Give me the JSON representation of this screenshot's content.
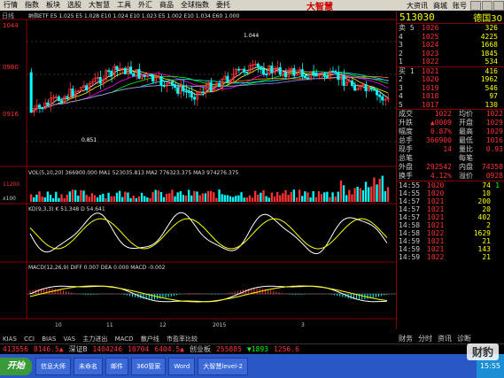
{
  "menu": {
    "items": [
      "行情",
      "指数",
      "板块",
      "选股",
      "大智慧",
      "工具",
      "外汇",
      "商品",
      "全球指数",
      "委托"
    ],
    "brand": "大智慧",
    "right_items": [
      "大资讯",
      "商城",
      "账号"
    ]
  },
  "chart_header": {
    "period": "日线",
    "ohlc_text": "纳指ETF  E5 1.025  E5 1.028  E10 1.024  E10 1.023  E5 1.002  E10 1.034  E60 1.000"
  },
  "price_axis": [
    "1044",
    "0980",
    "0916"
  ],
  "price_markers": {
    "high": "1.044",
    "low": "0.851"
  },
  "volume": {
    "title": "VOL(5,10,20)  366900.000  MA1 523035.813  MA2 776323.375  MA3 974276.375",
    "axis": [
      "11200",
      "x100"
    ]
  },
  "kdj": {
    "title": "KD(9,3,3)  K 51.348  D 54.641"
  },
  "macd": {
    "title": "MACD(12,26,9)  DIFF 0.007  DEA 0.000  MACD -0.002"
  },
  "x_axis": [
    "10",
    "11",
    "12",
    "2015",
    "3"
  ],
  "indicator_tabs": [
    "KIAS",
    "CCI",
    "BIAS",
    "VAS",
    "主力进出",
    "MACD",
    "散户线",
    "市盈率比较"
  ],
  "quote": {
    "code": "513030",
    "name": "德国30",
    "sell_label": "卖",
    "buy_label": "买",
    "sells": [
      {
        "lvl": "5",
        "p": "1026",
        "v": "326"
      },
      {
        "lvl": "4",
        "p": "1025",
        "v": "4225"
      },
      {
        "lvl": "3",
        "p": "1024",
        "v": "1668"
      },
      {
        "lvl": "2",
        "p": "1023",
        "v": "1845"
      },
      {
        "lvl": "1",
        "p": "1022",
        "v": "534"
      }
    ],
    "buys": [
      {
        "lvl": "1",
        "p": "1021",
        "v": "416"
      },
      {
        "lvl": "2",
        "p": "1020",
        "v": "1962"
      },
      {
        "lvl": "3",
        "p": "1019",
        "v": "546"
      },
      {
        "lvl": "4",
        "p": "1018",
        "v": "97"
      },
      {
        "lvl": "5",
        "p": "1017",
        "v": "130"
      }
    ],
    "stats": [
      {
        "l1": "成交",
        "v1": "1022",
        "l2": "均价",
        "v2": "1022"
      },
      {
        "l1": "升跌",
        "v1": "▲0009",
        "l2": "开盘",
        "v2": "1029"
      },
      {
        "l1": "幅度",
        "v1": "0.87%",
        "l2": "最高",
        "v2": "1029"
      },
      {
        "l1": "总手",
        "v1": "366900",
        "l2": "最低",
        "v2": "1016"
      },
      {
        "l1": "现手",
        "v1": "14",
        "l2": "量比",
        "v2": "0.93"
      },
      {
        "l1": "总笔",
        "v1": "",
        "l2": "每笔",
        "v2": ""
      },
      {
        "l1": "外盘",
        "v1": "292542",
        "l2": "内盘",
        "v2": "74358"
      },
      {
        "l1": "换手",
        "v1": "4.12%",
        "l2": "溢价",
        "v2": "0928"
      }
    ],
    "ticks": [
      {
        "t": "14:55",
        "p": "1020",
        "v": "74",
        "d": "1"
      },
      {
        "t": "14:55",
        "p": "1020",
        "v": "10",
        "d": ""
      },
      {
        "t": "14:57",
        "p": "1021",
        "v": "200",
        "d": ""
      },
      {
        "t": "14:57",
        "p": "1021",
        "v": "20",
        "d": ""
      },
      {
        "t": "14:57",
        "p": "1021",
        "v": "402",
        "d": ""
      },
      {
        "t": "14:58",
        "p": "1021",
        "v": "2",
        "d": ""
      },
      {
        "t": "14:58",
        "p": "1022",
        "v": "1629",
        "d": ""
      },
      {
        "t": "14:59",
        "p": "1021",
        "v": "21",
        "d": ""
      },
      {
        "t": "14:59",
        "p": "1021",
        "v": "143",
        "d": ""
      },
      {
        "t": "14:59",
        "p": "1022",
        "v": "21",
        "d": ""
      }
    ]
  },
  "side_tabs": [
    "财务",
    "分时",
    "资讯",
    "诊断"
  ],
  "index_bar": [
    {
      "text": "413556",
      "color": "#f33"
    },
    {
      "text": "8146.5▲",
      "color": "#f33"
    },
    {
      "text": "深证B",
      "color": "#ccc"
    },
    {
      "text": "1404246",
      "color": "#f33"
    },
    {
      "text": "10704",
      "color": "#f33"
    },
    {
      "text": "6404.5▲",
      "color": "#f33"
    },
    {
      "text": "创业板",
      "color": "#ccc"
    },
    {
      "text": "255885",
      "color": "#f33"
    },
    {
      "text": "▼1893",
      "color": "#0f0"
    },
    {
      "text": "1256.6",
      "color": "#f33"
    }
  ],
  "taskbar": {
    "start": "开始",
    "items": [
      "信息大师",
      "未命名",
      "邮件",
      "360管家",
      "Word",
      "大智慧level-2",
      "搜狗"
    ],
    "time": "15:55"
  },
  "watermark": "财豹"
}
